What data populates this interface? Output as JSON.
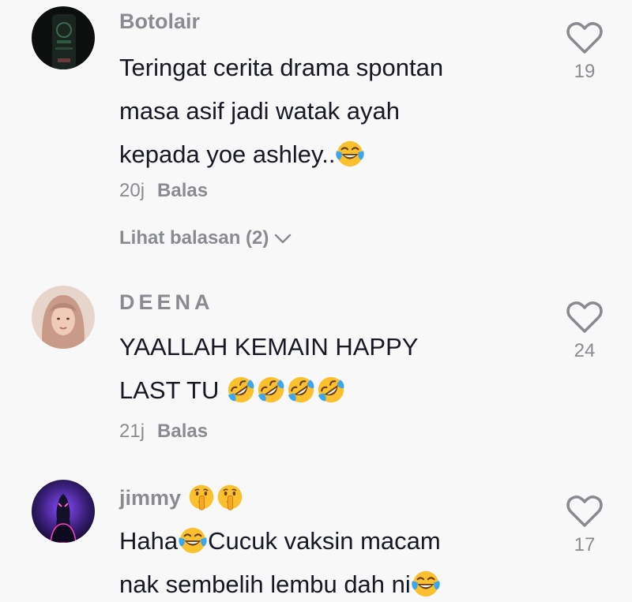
{
  "comments": [
    {
      "username": "Botolair",
      "lines": [
        "Teringat cerita drama spontan",
        "masa asif jadi watak ayah",
        "kepada yoe ashley.."
      ],
      "time": "20j",
      "reply_label": "Balas",
      "view_replies": "Lihat balasan (2)",
      "likes": "19"
    },
    {
      "username": "DEENA",
      "lines": [
        "YAALLAH KEMAIN HAPPY",
        "LAST TU "
      ],
      "time": "21j",
      "reply_label": "Balas",
      "likes": "24"
    },
    {
      "username": "jimmy",
      "lines": [
        "Haha",
        "Cucuk vaksin macam",
        "nak sembelih lembu dah ni"
      ],
      "likes": "17"
    }
  ],
  "icons": {
    "like": "heart-outline-icon",
    "expand": "chevron-down-icon",
    "laugh": "tears-of-joy-emoji",
    "rofl": "rolling-on-floor-laughing-emoji",
    "shush": "shushing-face-emoji"
  },
  "colors": {
    "background": "#f8f8f8",
    "primary_text": "#161823",
    "secondary_text": "#8a8b91",
    "emoji_yellow": "#fbc02d"
  }
}
